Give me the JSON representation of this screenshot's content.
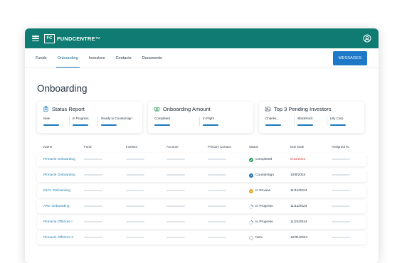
{
  "app": {
    "logo_mark": "FC",
    "logo_text": "FUNDCENTRE",
    "trademark": "™"
  },
  "nav": {
    "tabs": [
      {
        "label": "Funds",
        "active": false
      },
      {
        "label": "Onboarding",
        "active": true
      },
      {
        "label": "Investors",
        "active": false
      },
      {
        "label": "Contacts",
        "active": false
      },
      {
        "label": "Documents",
        "active": false
      }
    ],
    "messages_button": "MESSAGES"
  },
  "page": {
    "title": "Onboarding"
  },
  "cards": [
    {
      "title": "Status Report",
      "icon": "clipboard-icon",
      "metrics": [
        "New",
        "In Progress",
        "Ready to Countersign"
      ]
    },
    {
      "title": "Onboarding Amount",
      "icon": "money-stack-icon",
      "metrics": [
        "Completed",
        "In Flight"
      ]
    },
    {
      "title": "Top 3 Pending Investors",
      "icon": "image-icon",
      "metrics": [
        "Charles...",
        "BlackRock",
        "Lilly Corp."
      ]
    }
  ],
  "table": {
    "headers": [
      "Name",
      "Fund",
      "Investor",
      "Account",
      "Primary Contact",
      "Status",
      "Due Date",
      "Assigned To"
    ],
    "rows": [
      {
        "name": "Pinnacle Onboarding",
        "status": "Completed",
        "status_icon": "check-circle-icon",
        "due": "9/10/2024",
        "overdue": true
      },
      {
        "name": "Pinnacle Onboarding",
        "status": "Countersign",
        "status_icon": "pen-circle-icon",
        "due": "10/8/2024",
        "overdue": false
      },
      {
        "name": "DLFL Onboarding",
        "status": "In Review",
        "status_icon": "review-circle-icon",
        "due": "11/11/2024",
        "overdue": false
      },
      {
        "name": "ARC Onboarding",
        "status": "In Progress",
        "status_icon": "progress-circle-icon",
        "due": "11/11/2024",
        "overdue": false
      },
      {
        "name": "Pinnacle Offshore I",
        "status": "In Progress",
        "status_icon": "progress-circle-icon",
        "due": "11/22/2024",
        "overdue": false
      },
      {
        "name": "Pinnacle Offshore II",
        "status": "New",
        "status_icon": "new-circle-icon",
        "due": "12/31/2024",
        "overdue": false
      }
    ]
  },
  "colors": {
    "brand": "#0f7b72",
    "accent": "#1d78c8",
    "link": "#1f7fb0",
    "overdue": "#d24646",
    "completed": "#2e9e5b",
    "countersign": "#1d6fa8",
    "in_review": "#e0a526"
  }
}
